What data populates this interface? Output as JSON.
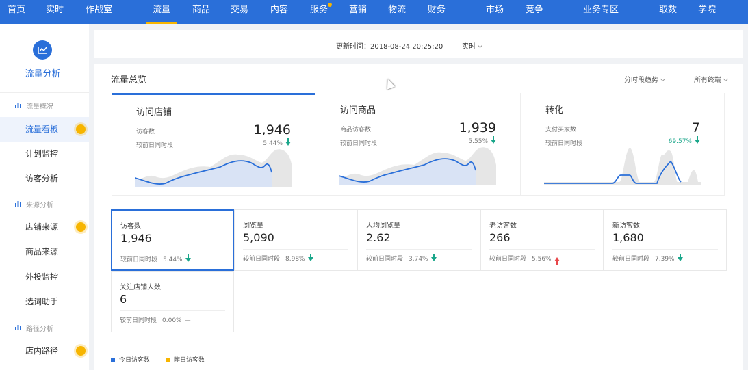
{
  "topnav": {
    "items": [
      "首页",
      "实时",
      "作战室",
      "流量",
      "商品",
      "交易",
      "内容",
      "服务",
      "营销",
      "物流",
      "财务",
      "市场",
      "竞争",
      "业务专区",
      "取数",
      "学院"
    ],
    "active": "流量"
  },
  "sidebar": {
    "title": "流量分析",
    "groups": [
      "流量概况",
      "来源分析",
      "路径分析"
    ],
    "items": [
      "流量看板",
      "计划监控",
      "访客分析",
      "店铺来源",
      "商品来源",
      "外投监控",
      "选词助手",
      "店内路径"
    ]
  },
  "updatebar": {
    "label": "更新时间：2018-08-24 20:25:20",
    "mode": "实时"
  },
  "overview": {
    "title": "流量总览",
    "filters": [
      "分时段趋势",
      "所有终端"
    ],
    "summary_cards": [
      {
        "title": "访问店铺",
        "label": "访客数",
        "value": "1,946",
        "compare_label": "较前日同时段",
        "pct": "5.44%"
      },
      {
        "title": "访问商品",
        "label": "商品访客数",
        "value": "1,939",
        "compare_label": "较前日同时段",
        "pct": "5.55%"
      },
      {
        "title": "转化",
        "label": "支付买家数",
        "value": "7",
        "compare_label": "较前日同时段",
        "pct": "69.57%"
      }
    ],
    "metrics": [
      {
        "label": "访客数",
        "value": "1,946",
        "compare_label": "较前日同时段",
        "pct": "5.44%",
        "trend": "down"
      },
      {
        "label": "浏览量",
        "value": "5,090",
        "compare_label": "较前日同时段",
        "pct": "8.98%",
        "trend": "down"
      },
      {
        "label": "人均浏览量",
        "value": "2.62",
        "compare_label": "较前日同时段",
        "pct": "3.74%",
        "trend": "down"
      },
      {
        "label": "老访客数",
        "value": "266",
        "compare_label": "较前日同时段",
        "pct": "5.56%",
        "trend": "up"
      },
      {
        "label": "新访客数",
        "value": "1,680",
        "compare_label": "较前日同时段",
        "pct": "7.39%",
        "trend": "down"
      },
      {
        "label": "关注店铺人数",
        "value": "6",
        "compare_label": "较前日同时段",
        "pct": "0.00%",
        "trend": "flat"
      }
    ],
    "legend": [
      {
        "label": "今日访客数",
        "color": "#2a6fd9"
      },
      {
        "label": "昨日访客数",
        "color": "#f7b500"
      }
    ]
  },
  "colors": {
    "primary": "#2a6fd9",
    "accent": "#f7b500",
    "down": "#1aa68a",
    "up": "#e8464a"
  }
}
